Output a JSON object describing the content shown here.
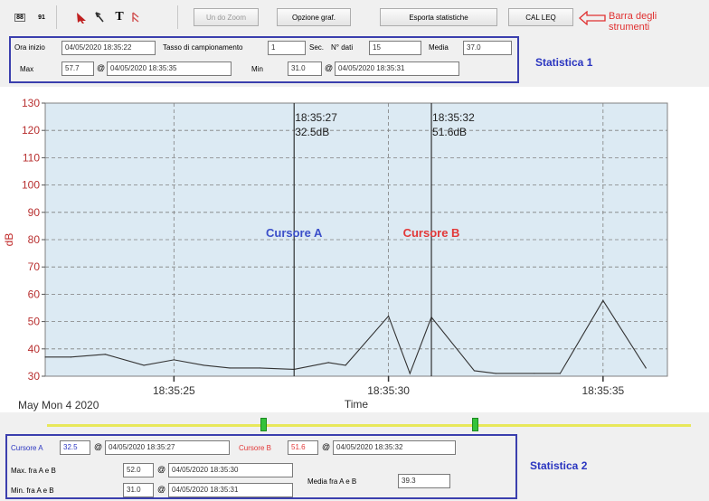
{
  "toolbar": {
    "icon1_label": "88",
    "icon2_label": "91",
    "text_tool": "T",
    "btn_undo_zoom": "Un do Zoom",
    "btn_graph_options": "Opzione graf.",
    "btn_export_stats": "Esporta statistiche",
    "btn_cal_leq": "CAL LEQ",
    "callout_line1": "Barra degli",
    "callout_line2": "strumenti"
  },
  "stats1": {
    "title": "Statistica 1",
    "start_label": "Ora inizio",
    "start_value": "04/05/2020 18:35:22",
    "sampling_label": "Tasso di campionamento",
    "sampling_value": "1",
    "sec_label": "Sec.",
    "ndata_label": "N° dati",
    "ndata_value": "15",
    "mean_label": "Media",
    "mean_value": "37.0",
    "max_label": "Max",
    "max_value": "57.7",
    "max_at": "@",
    "max_time": "04/05/2020 18:35:35",
    "min_label": "Min",
    "min_value": "31.0",
    "min_at": "@",
    "min_time": "04/05/2020 18:35:31"
  },
  "chart_data": {
    "type": "line",
    "xlabel": "Time",
    "ylabel": "dB",
    "date_label": "May Mon 4 2020",
    "ylim": [
      30,
      130
    ],
    "yticks": [
      30,
      40,
      50,
      60,
      70,
      80,
      90,
      100,
      110,
      120,
      130
    ],
    "xticks": [
      {
        "label": "18:35:25",
        "t": 3
      },
      {
        "label": "18:35:30",
        "t": 8
      },
      {
        "label": "18:35:35",
        "t": 13
      }
    ],
    "xlim": [
      0,
      14.5
    ],
    "series": [
      {
        "x": [
          0,
          0.6,
          1.4,
          2.3,
          3.0,
          3.7,
          4.3,
          5,
          5.8,
          6.6,
          7.0,
          8.0,
          8.5,
          9.0,
          10.0,
          10.5,
          11.4,
          12.0,
          13.0,
          14.0
        ],
        "values": [
          37,
          37,
          38,
          34,
          36,
          34,
          33,
          33,
          32.5,
          35,
          34,
          52,
          31,
          51.6,
          32,
          31,
          31,
          31,
          57.7,
          33
        ]
      }
    ],
    "cursor_a": {
      "t": 5.8,
      "time": "18:35:27",
      "value": "32.5dB",
      "label": "Cursore A",
      "color": "#3b4fc9"
    },
    "cursor_b": {
      "t": 9.0,
      "time": "18:35:32",
      "value": "51.6dB",
      "label": "Cursore B",
      "color": "#e23838"
    },
    "grid": true,
    "plot_bg": "#dceaf3"
  },
  "stats2": {
    "title": "Statistica 2",
    "cursor_a_label": "Cursore A",
    "cursor_a_value": "32.5",
    "cursor_a_at": "@",
    "cursor_a_time": "04/05/2020 18:35:27",
    "cursor_b_label": "Cursore B",
    "cursor_b_value": "51.6",
    "cursor_b_at": "@",
    "cursor_b_time": "04/05/2020 18:35:32",
    "max_label": "Max. fra A e B",
    "max_value": "52.0",
    "max_at": "@",
    "max_time": "04/05/2020 18:35:30",
    "min_label": "Min. fra A e B",
    "min_value": "31.0",
    "min_at": "@",
    "min_time": "04/05/2020 18:35:31",
    "mean_label": "Media fra  A e B",
    "mean_value": "39.3"
  },
  "slider": {
    "a_fraction": 0.335,
    "b_fraction": 0.665
  }
}
